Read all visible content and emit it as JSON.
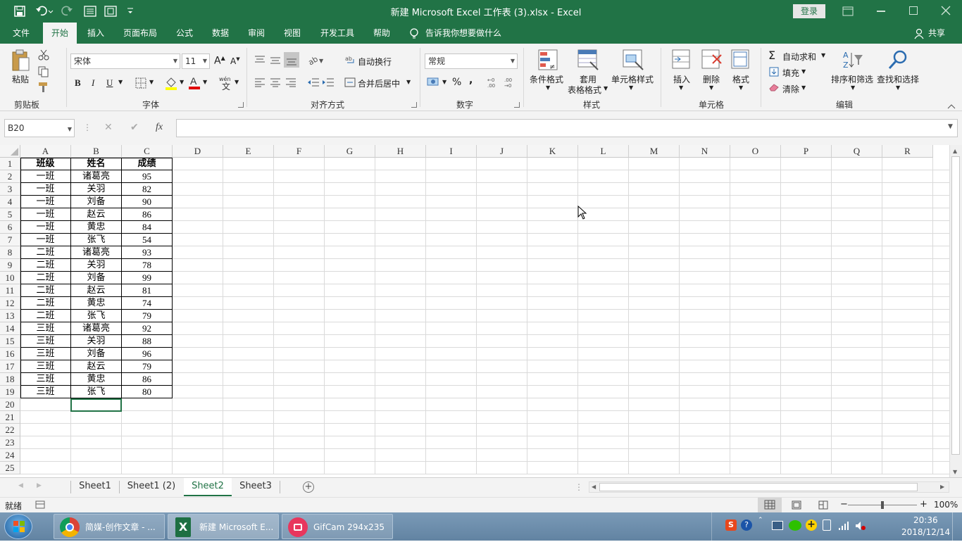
{
  "app": {
    "title": "新建 Microsoft Excel 工作表 (3).xlsx  -  Excel",
    "login": "登录"
  },
  "tabs": {
    "file": "文件",
    "home": "开始",
    "insert": "插入",
    "layout": "页面布局",
    "formula": "公式",
    "data": "数据",
    "review": "审阅",
    "view": "视图",
    "developer": "开发工具",
    "help": "帮助",
    "tell": "告诉我你想要做什么",
    "share": "共享"
  },
  "ribbon": {
    "clipboard": {
      "paste": "粘贴",
      "label": "剪贴板"
    },
    "font": {
      "name": "宋体",
      "size": "11",
      "bold": "B",
      "italic": "I",
      "underline": "U",
      "label": "字体"
    },
    "align": {
      "wrap": "自动换行",
      "merge": "合并后居中",
      "label": "对齐方式"
    },
    "number": {
      "format": "常规",
      "percent": "%",
      "comma": ",",
      "label": "数字"
    },
    "styles": {
      "cond": "条件格式",
      "table1": "套用",
      "table2": "表格格式",
      "cell": "单元格样式",
      "label": "样式"
    },
    "cells": {
      "insert": "插入",
      "delete": "删除",
      "format": "格式",
      "label": "单元格"
    },
    "edit": {
      "autosum": "自动求和",
      "fill": "填充",
      "clear": "清除",
      "sort": "排序和筛选",
      "find": "查找和选择",
      "label": "编辑"
    }
  },
  "formula_bar": {
    "namebox": "B20",
    "fx": "fx",
    "value": ""
  },
  "columns": [
    "A",
    "B",
    "C",
    "D",
    "E",
    "F",
    "G",
    "H",
    "I",
    "J",
    "K",
    "L",
    "M",
    "N",
    "O",
    "P",
    "Q",
    "R"
  ],
  "rows": [
    "1",
    "2",
    "3",
    "4",
    "5",
    "6",
    "7",
    "8",
    "9",
    "10",
    "11",
    "12",
    "13",
    "14",
    "15",
    "16",
    "17",
    "18",
    "19",
    "20",
    "21",
    "22",
    "23",
    "24",
    "25"
  ],
  "table": {
    "headers": [
      "班级",
      "姓名",
      "成绩"
    ],
    "data": [
      [
        "一班",
        "诸葛亮",
        "95"
      ],
      [
        "一班",
        "关羽",
        "82"
      ],
      [
        "一班",
        "刘备",
        "90"
      ],
      [
        "一班",
        "赵云",
        "86"
      ],
      [
        "一班",
        "黄忠",
        "84"
      ],
      [
        "一班",
        "张飞",
        "54"
      ],
      [
        "二班",
        "诸葛亮",
        "93"
      ],
      [
        "二班",
        "关羽",
        "78"
      ],
      [
        "二班",
        "刘备",
        "99"
      ],
      [
        "二班",
        "赵云",
        "81"
      ],
      [
        "二班",
        "黄忠",
        "74"
      ],
      [
        "二班",
        "张飞",
        "79"
      ],
      [
        "三班",
        "诸葛亮",
        "92"
      ],
      [
        "三班",
        "关羽",
        "88"
      ],
      [
        "三班",
        "刘备",
        "96"
      ],
      [
        "三班",
        "赵云",
        "79"
      ],
      [
        "三班",
        "黄忠",
        "86"
      ],
      [
        "三班",
        "张飞",
        "80"
      ]
    ]
  },
  "sheets": {
    "s1": "Sheet1",
    "s2": "Sheet1 (2)",
    "s3": "Sheet2",
    "s4": "Sheet3"
  },
  "status": {
    "ready": "就绪",
    "zoom": "100%",
    "minus": "−",
    "plus": "+"
  },
  "taskbar": {
    "chrome": "简媒-创作文章 - ...",
    "excel": "新建 Microsoft E...",
    "gifcam": "GifCam 294x235",
    "time": "20:36",
    "date": "2018/12/14"
  },
  "colors": {
    "accent": "#217346"
  }
}
